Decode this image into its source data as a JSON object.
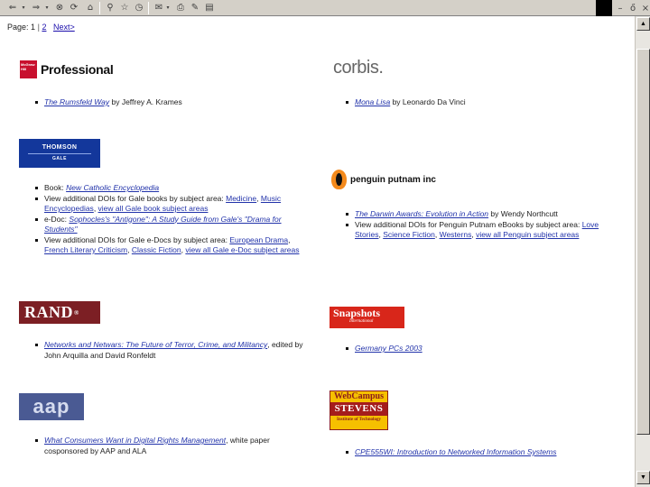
{
  "toolbar": {
    "buttons": [
      "back-icon",
      "dropdown-arrow-icon",
      "forward-icon",
      "dropdown-arrow-icon",
      "stop-icon",
      "refresh-icon",
      "home-icon",
      "search-icon",
      "favorites-icon",
      "history-icon",
      "mail-icon",
      "print-icon",
      "edit-icon",
      "discuss-icon"
    ],
    "window_controls": {
      "minimize": "–",
      "restore": "ő",
      "close": "×"
    }
  },
  "pager": {
    "label": "Page:",
    "current": "1",
    "separator": "|",
    "next_page": "2",
    "next_label": "Next>"
  },
  "publishers": {
    "mcgraw": {
      "logo_box": "McGraw Hill",
      "logo_text": "Professional",
      "items": [
        {
          "link": "The Rumsfeld Way",
          "rest": " by Jeffrey A. Krames"
        }
      ]
    },
    "corbis": {
      "logo_text": "corbis.",
      "items": [
        {
          "link": "Mona Lisa",
          "rest": " by Leonardo Da Vinci"
        }
      ]
    },
    "thomson": {
      "logo_top": "THOMSON",
      "logo_bottom": "GALE",
      "items": [
        {
          "pre": "Book: ",
          "link": "New Catholic Encyclopedia",
          "rest": ""
        },
        {
          "pre": "View additional DOIs for Gale books by subject area: ",
          "link": "Medicine",
          "rest": ", ",
          "link2": "Music Encyclopedias",
          "rest2": ", ",
          "link3": "view all Gale book subject areas",
          "rest3": ""
        },
        {
          "pre": "e-Doc: ",
          "link": "Sophocles's \"Antigone\": A Study Guide from Gale's \"Drama for Students\"",
          "rest": ""
        },
        {
          "pre": "View additional DOIs for Gale e-Docs by subject area: ",
          "link": "European Drama",
          "rest": ", ",
          "link2": "French Literary Criticism",
          "rest2": ", ",
          "link3": "Classic Fiction",
          "rest3": ", ",
          "link4": "view all Gale e-Doc subject areas",
          "rest4": ""
        }
      ]
    },
    "penguin": {
      "logo_text": "penguin putnam inc",
      "items": [
        {
          "link": "The Darwin Awards: Evolution in Action",
          "rest": " by Wendy Northcutt"
        },
        {
          "pre": "View additional DOIs for Penguin Putnam eBooks by subject area: ",
          "link": "Love Stories",
          "rest": ", ",
          "link2": "Science Fiction",
          "rest2": ", ",
          "link3": "Westerns",
          "rest3": ", ",
          "link4": "view all Penguin subject areas",
          "rest4": ""
        }
      ]
    },
    "rand": {
      "logo_text": "RAND",
      "logo_mark": "®",
      "items": [
        {
          "link": "Networks and Netwars: The Future of Terror, Crime, and Militancy",
          "rest": ", edited by John Arquilla and David Ronfeldt"
        }
      ]
    },
    "snapshots": {
      "logo_top": "Snapshots",
      "logo_bottom": "International",
      "items": [
        {
          "link": "Germany PCs 2003",
          "rest": ""
        }
      ]
    },
    "aap": {
      "logo_text": "aap",
      "items": [
        {
          "link": "What Consumers Want in Digital Rights Management",
          "rest": ", white paper cosponsored by AAP and ALA"
        }
      ]
    },
    "webcampus": {
      "logo_top": "WebCampus",
      "logo_mid": "STEVENS",
      "logo_bottom": "Institute of Technology",
      "items": [
        {
          "link": "CPE555WI: Introduction to Networked Information Systems",
          "rest": ""
        }
      ]
    }
  }
}
